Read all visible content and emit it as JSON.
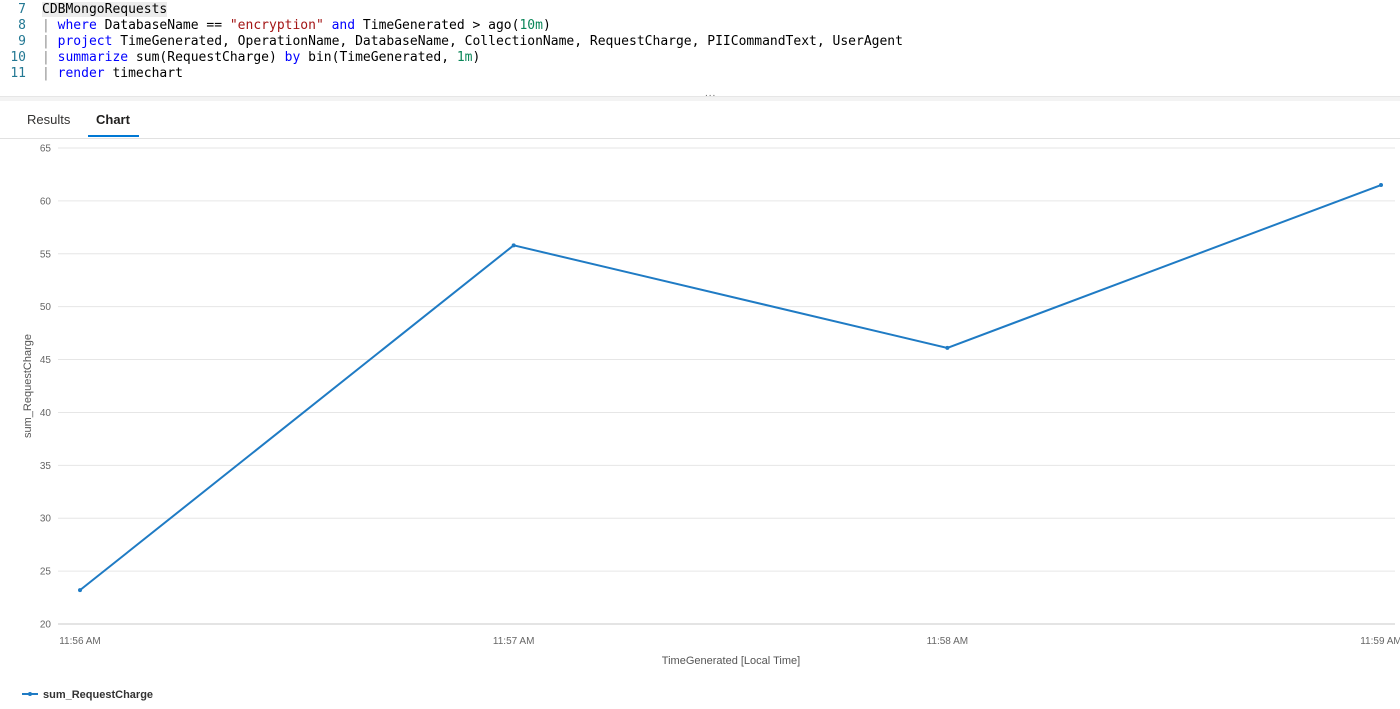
{
  "editor": {
    "lines": [
      {
        "num": "7",
        "segments": [
          {
            "text": "CDBMongoRequests",
            "cls": "hl"
          }
        ]
      },
      {
        "num": "8",
        "segments": [
          {
            "text": "| ",
            "cls": "bar"
          },
          {
            "text": "where",
            "cls": "kw"
          },
          {
            "text": " DatabaseName == ",
            "cls": ""
          },
          {
            "text": "\"encryption\"",
            "cls": "str"
          },
          {
            "text": " ",
            "cls": ""
          },
          {
            "text": "and",
            "cls": "kw"
          },
          {
            "text": " TimeGenerated > ago(",
            "cls": ""
          },
          {
            "text": "10m",
            "cls": "num"
          },
          {
            "text": ")",
            "cls": ""
          }
        ]
      },
      {
        "num": "9",
        "segments": [
          {
            "text": "| ",
            "cls": "bar"
          },
          {
            "text": "project",
            "cls": "kw"
          },
          {
            "text": " TimeGenerated, OperationName, DatabaseName, CollectionName, RequestCharge, PIICommandText, UserAgent",
            "cls": ""
          }
        ]
      },
      {
        "num": "10",
        "segments": [
          {
            "text": "| ",
            "cls": "bar"
          },
          {
            "text": "summarize",
            "cls": "kw"
          },
          {
            "text": " sum(RequestCharge) ",
            "cls": ""
          },
          {
            "text": "by",
            "cls": "kw"
          },
          {
            "text": " bin(TimeGenerated, ",
            "cls": ""
          },
          {
            "text": "1m",
            "cls": "num"
          },
          {
            "text": ")",
            "cls": ""
          }
        ]
      },
      {
        "num": "11",
        "segments": [
          {
            "text": "| ",
            "cls": "bar"
          },
          {
            "text": "render",
            "cls": "kw"
          },
          {
            "text": " timechart",
            "cls": ""
          }
        ]
      }
    ]
  },
  "splitter": {
    "dots": "..."
  },
  "tabs": {
    "results": "Results",
    "chart": "Chart",
    "active": "chart"
  },
  "colors": {
    "accent": "#0078d4",
    "series": "#1f7bc4"
  },
  "chart_data": {
    "type": "line",
    "x": [
      "11:56 AM",
      "11:57 AM",
      "11:58 AM",
      "11:59 AM"
    ],
    "series": [
      {
        "name": "sum_RequestCharge",
        "values": [
          23.2,
          55.8,
          46.1,
          61.5
        ]
      }
    ],
    "xlabel": "TimeGenerated [Local Time]",
    "ylabel": "sum_RequestCharge",
    "ylim": [
      20,
      65
    ],
    "yticks": [
      20,
      25,
      30,
      35,
      40,
      45,
      50,
      55,
      60,
      65
    ],
    "grid": true,
    "legend": "bottom-left"
  }
}
